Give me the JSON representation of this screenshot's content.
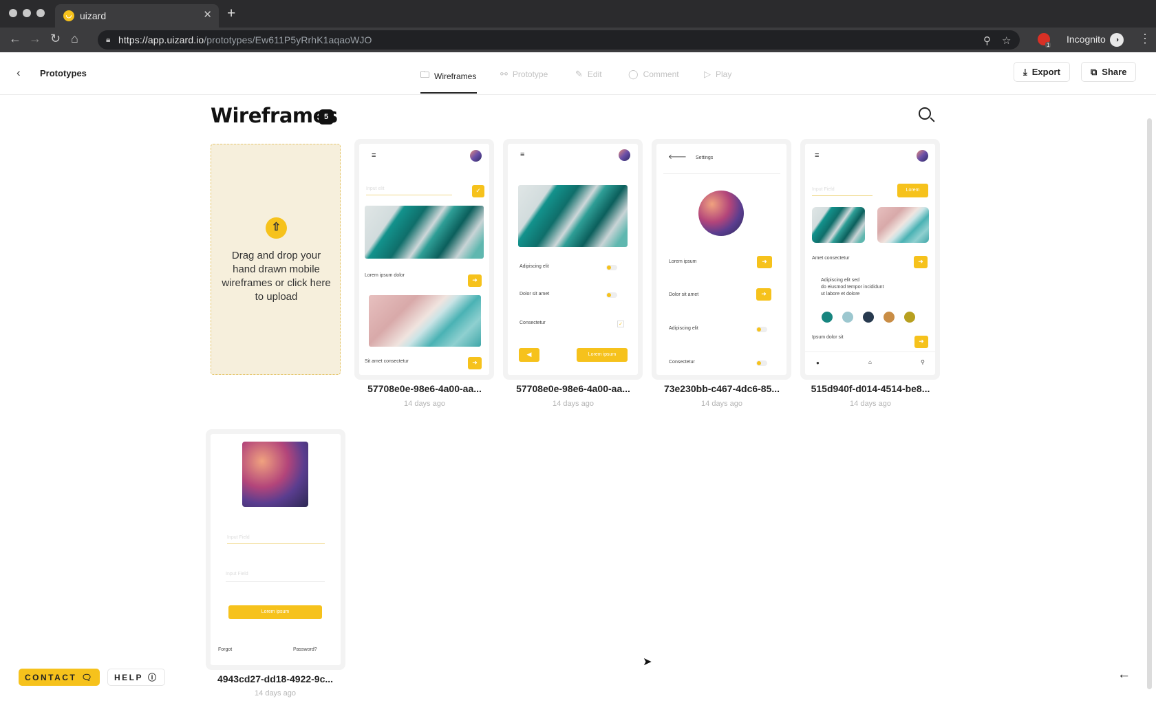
{
  "browser": {
    "tab_title": "uizard",
    "tab_close": "✕",
    "new_tab": "+",
    "url_host": "https://app.uizard.io",
    "url_path": "/prototypes/Ew611P5yRrhK1aqaoWJO",
    "profile_label": "Incognito",
    "extension_badge": "1"
  },
  "header": {
    "back_label": "Prototypes",
    "tabs": [
      {
        "label": "Wireframes",
        "active": true
      },
      {
        "label": "Prototype",
        "active": false
      },
      {
        "label": "Edit",
        "active": false
      },
      {
        "label": "Comment",
        "active": false
      },
      {
        "label": "Play",
        "active": false
      }
    ],
    "export_label": "Export",
    "share_label": "Share"
  },
  "page": {
    "title": "Wireframes",
    "count": "5",
    "upload_text": "Drag and drop your hand drawn mobile wireframes or click here to upload"
  },
  "cards": [
    {
      "name": "57708e0e-98e6-4a00-aa...",
      "date": "14 days ago"
    },
    {
      "name": "57708e0e-98e6-4a00-aa...",
      "date": "14 days ago"
    },
    {
      "name": "73e230bb-c467-4dc6-85...",
      "date": "14 days ago"
    },
    {
      "name": "515d940f-d014-4514-be8...",
      "date": "14 days ago"
    },
    {
      "name": "4943cd27-dd18-4922-9c...",
      "date": "14 days ago"
    }
  ],
  "wireframe_text": {
    "c1": {
      "input": "Input elit",
      "label1": "Lorem ipsum dolor",
      "label2": "Sit amet consectetur"
    },
    "c2": {
      "row1": "Adipiscing elit",
      "row2": "Dolor sit amet",
      "row3": "Consectetur",
      "btn": "Lorem ipsum"
    },
    "c3": {
      "title": "Settings",
      "row1": "Lorem ipsum",
      "row2": "Dolor sit amet",
      "row3": "Adipiscing elit",
      "row4": "Consectetur"
    },
    "c4": {
      "input": "Input Field",
      "btn": "Lorem",
      "label1": "Amet consectetur",
      "para1": "Adipiscing elit sed",
      "para2": "do eiusmod tempor incididunt",
      "para3": "ut labore et dolore",
      "label2": "Ipsum dolor sit"
    },
    "c5": {
      "field1": "Input Field",
      "field2": "Input Field",
      "btn": "Lorem ipsum",
      "forgot": "Forgot",
      "password": "Password?"
    }
  },
  "floating": {
    "contact_label": "CONTACT",
    "help_label": "HELP"
  },
  "colors": {
    "accent": "#f6c21c",
    "dark": "#111111"
  }
}
